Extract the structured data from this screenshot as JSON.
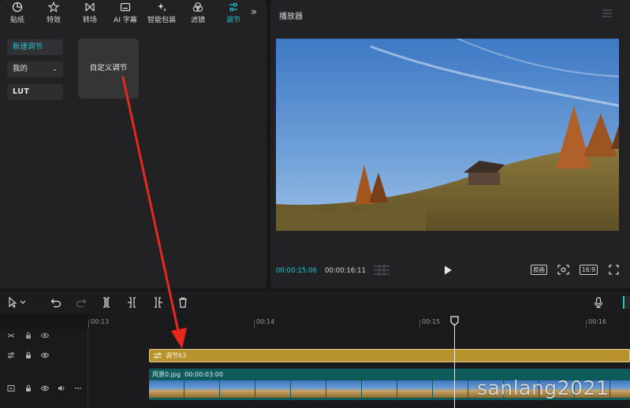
{
  "tabs": [
    {
      "label": "贴纸",
      "icon": "sticker-icon"
    },
    {
      "label": "特效",
      "icon": "effects-icon"
    },
    {
      "label": "转场",
      "icon": "transition-icon"
    },
    {
      "label": "AI 字幕",
      "icon": "caption-icon"
    },
    {
      "label": "智能包装",
      "icon": "smart-pack-icon"
    },
    {
      "label": "滤镜",
      "icon": "filter-icon"
    },
    {
      "label": "调节",
      "icon": "adjust-icon",
      "active": true
    }
  ],
  "sidebar": {
    "new_adjust": "新建调节",
    "mine": "我的",
    "lut": "LUT"
  },
  "custom_card": "自定义调节",
  "player": {
    "title": "播放器",
    "current_time": "00:00:15:06",
    "total_time": "00:00:16:11",
    "original_label": "原画",
    "ratio_label": "16:9"
  },
  "ruler": {
    "labels": [
      "00:13",
      "00:14",
      "00:15",
      "00:16"
    ]
  },
  "tracks": {
    "adjust_clip_label": "调节63",
    "video_clip_name": "风景0.jpg",
    "video_clip_duration": "00:00:03:00"
  },
  "watermark": "sanlang2021",
  "colors": {
    "accent": "#1ec8d2",
    "adjust_clip": "#b8922f",
    "video_clip": "#0f5a5a",
    "arrow": "#e8281e"
  }
}
